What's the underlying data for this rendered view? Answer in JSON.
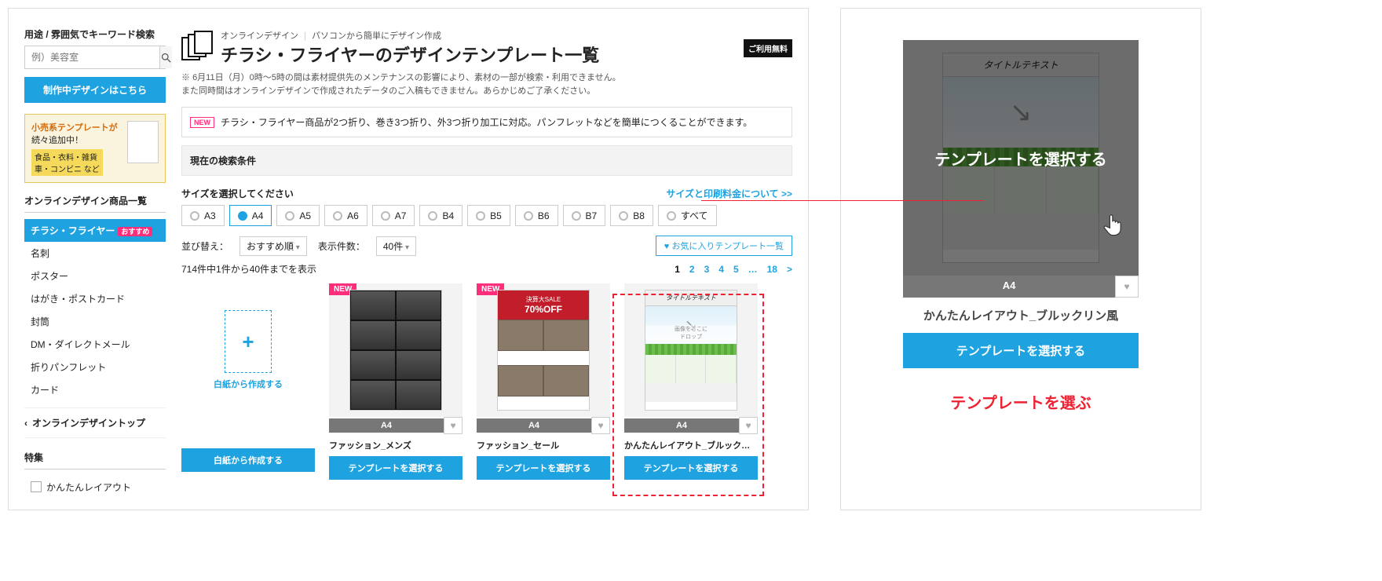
{
  "sidebar": {
    "search_label": "用途 / 雰囲気でキーワード検索",
    "search_placeholder": "例）美容室",
    "cta": "制作中デザインはこちら",
    "promo_line1": "小売系テンプレートが",
    "promo_line2": "続々追加中！",
    "promo_tags": "食品・衣料・雑貨\n車・コンビニ など",
    "heading": "オンラインデザイン商品一覧",
    "categories": [
      {
        "label": "チラシ・フライヤー",
        "badge": "おすすめ",
        "active": true
      },
      {
        "label": "名刺"
      },
      {
        "label": "ポスター"
      },
      {
        "label": "はがき・ポストカード"
      },
      {
        "label": "封筒"
      },
      {
        "label": "DM・ダイレクトメール"
      },
      {
        "label": "折りパンフレット"
      },
      {
        "label": "カード"
      }
    ],
    "back_link": "オンラインデザイントップ",
    "filter_heading": "特集",
    "filter_item": "かんたんレイアウト"
  },
  "main": {
    "breadcrumb_a": "オンラインデザイン",
    "breadcrumb_b": "パソコンから簡単にデザイン作成",
    "title": "チラシ・フライヤーのデザインテンプレート一覧",
    "free_badge": "ご利用無料",
    "notice": "6月11日（月）0時〜5時の間は素材提供先のメンテナンスの影響により、素材の一部が検索・利用できません。\nまた同時間はオンラインデザインで作成されたデータのご入稿もできません。あらかじめご了承ください。",
    "info_new": "NEW",
    "info_text": "チラシ・フライヤー商品が2つ折り、巻き3つ折り、外3つ折り加工に対応。パンフレットなどを簡単につくることができます。",
    "cond_title": "現在の検索条件",
    "size_label": "サイズを選択してください",
    "size_link": "サイズと印刷料金について >>",
    "sizes": [
      "A3",
      "A4",
      "A5",
      "A6",
      "A7",
      "B4",
      "B5",
      "B6",
      "B7",
      "B8",
      "すべて"
    ],
    "active_size": "A4",
    "sort_label": "並び替え：",
    "sort_value": "おすすめ順",
    "perpage_label": "表示件数：",
    "perpage_value": "40件",
    "fav_link": "お気に入りテンプレート一覧",
    "result_count": "714件中1件から40件までを表示",
    "pages": [
      "1",
      "2",
      "3",
      "4",
      "5",
      "…",
      "18",
      ">"
    ],
    "current_page": "1",
    "blank_plus": "+",
    "blank_label": "白紙から作成する",
    "blank_btn": "白紙から作成する",
    "cards": [
      {
        "ribbon": "NEW",
        "size": "A4",
        "name": "ファッション_メンズ",
        "btn": "テンプレートを選択する",
        "type": "fashion"
      },
      {
        "ribbon": "NEW",
        "size": "A4",
        "name": "ファッション_セール",
        "btn": "テンプレートを選択する",
        "type": "sale",
        "sale_top": "決算大SALE",
        "sale_pct": "70%OFF"
      },
      {
        "size": "A4",
        "name": "かんたんレイアウト_ブルックリン風",
        "btn": "テンプレートを選択する",
        "type": "brooklyn",
        "thumb_title": "タイトルテキスト",
        "thumb_drop": "画像をここに\nドロップ"
      }
    ]
  },
  "right": {
    "overlay": "テンプレートを選択する",
    "thumb_title": "タイトルテキスト",
    "size": "A4",
    "name": "かんたんレイアウト_ブルックリン風",
    "btn": "テンプレートを選択する",
    "caption": "テンプレートを選ぶ"
  }
}
